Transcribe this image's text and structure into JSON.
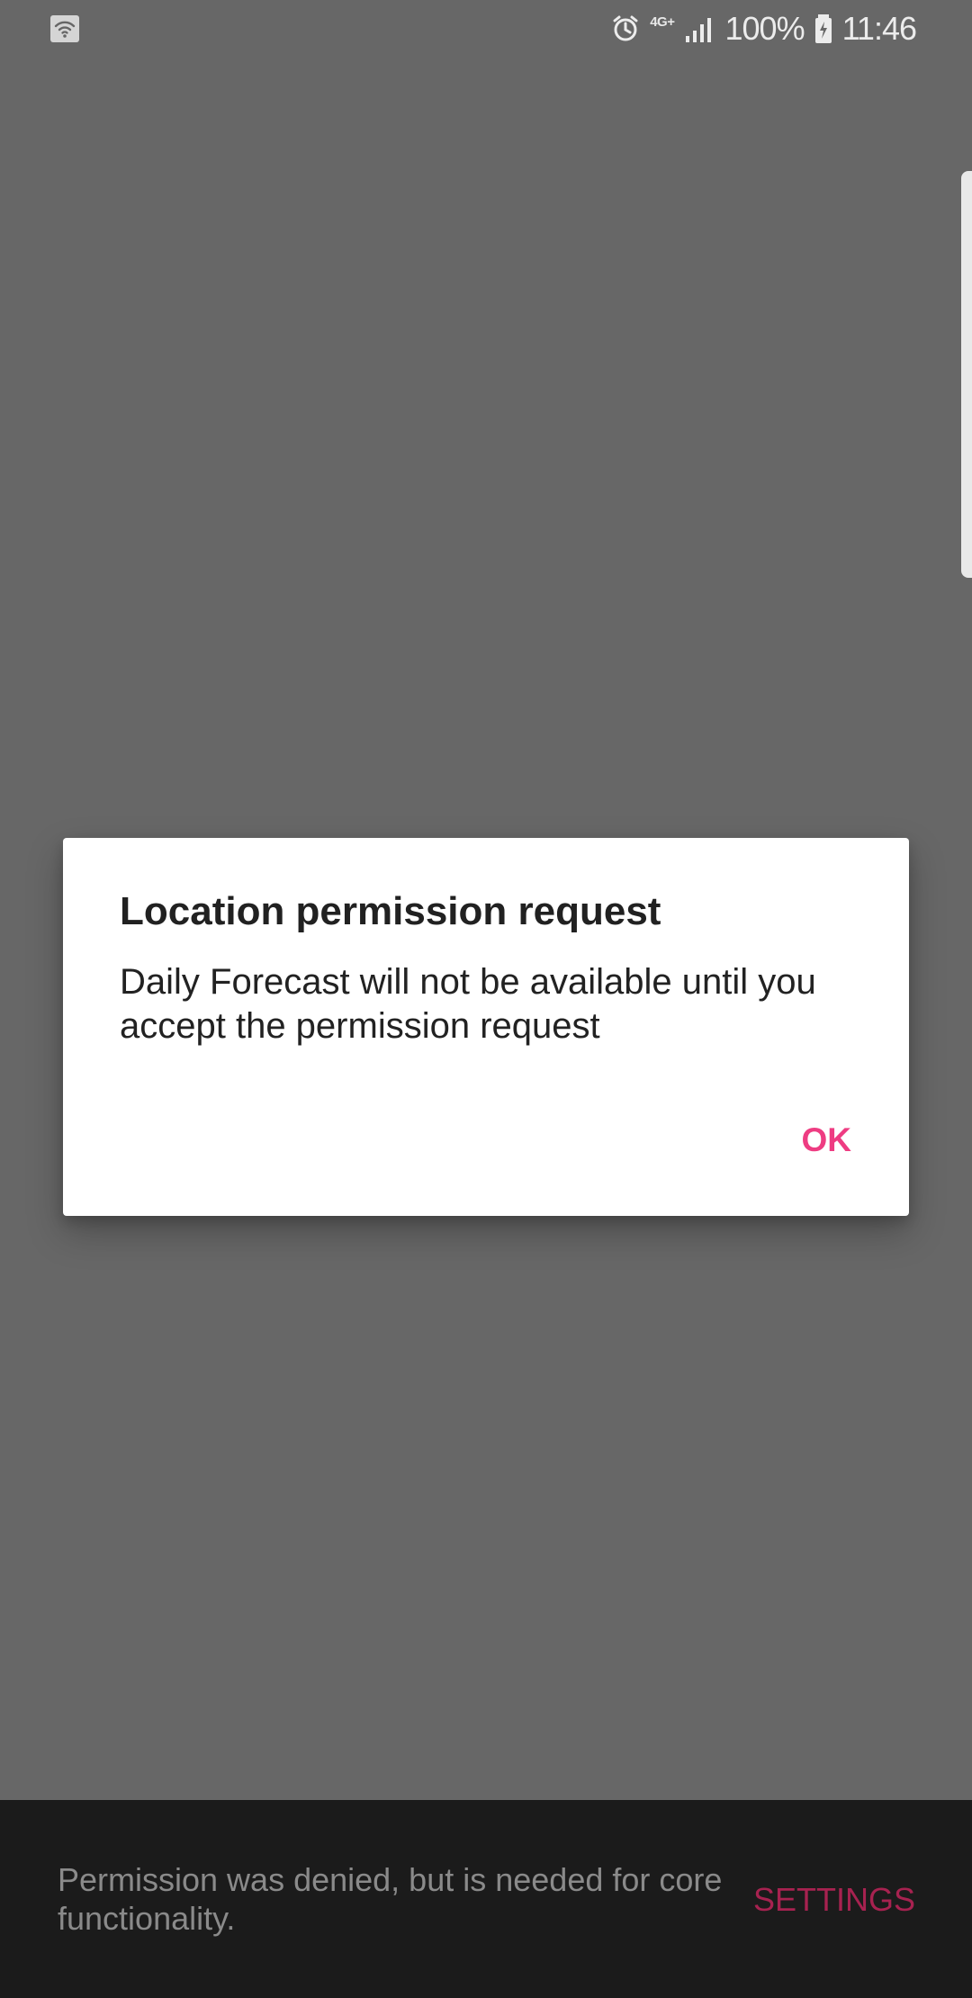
{
  "status_bar": {
    "left_icon": "wifi-tile-icon",
    "alarm_icon": "alarm-icon",
    "network_type": "4G+",
    "signal_icon": "signal-icon",
    "battery_percent": "100%",
    "battery_icon": "battery-charging-icon",
    "time": "11:46"
  },
  "dialog": {
    "title": "Location permission request",
    "message": "Daily Forecast will not be available until you accept the permission request",
    "ok_label": "OK"
  },
  "snackbar": {
    "message": "Permission was denied, but is needed for core functionality.",
    "action_label": "SETTINGS"
  },
  "colors": {
    "overlay": "#676767",
    "accent": "#ee3c82",
    "snackbar_background": "#1b1b1b",
    "snackbar_action": "#a72250"
  }
}
